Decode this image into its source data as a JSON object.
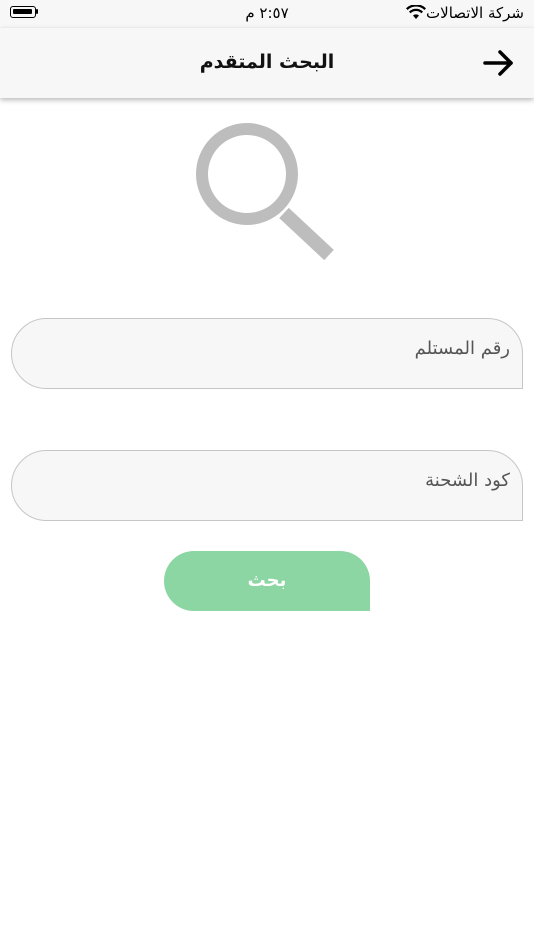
{
  "status_bar": {
    "carrier": "شركة الاتصالات",
    "time": "٢:٥٧ م",
    "icons": [
      "battery-icon",
      "wifi-icon"
    ]
  },
  "header": {
    "title": "البحث المتقدم",
    "back_icon": "arrow-right-icon"
  },
  "hero": {
    "icon": "search-icon",
    "color": "#bdbdbd"
  },
  "form": {
    "recipient_placeholder": "رقم المستلم",
    "shipment_code_placeholder": "كود الشحنة",
    "submit_label": "بحث"
  },
  "colors": {
    "button_bg": "#8cd6a3",
    "field_bg": "#f7f7f7",
    "field_border": "#c6c6c6",
    "header_bg": "#f7f7f7"
  }
}
